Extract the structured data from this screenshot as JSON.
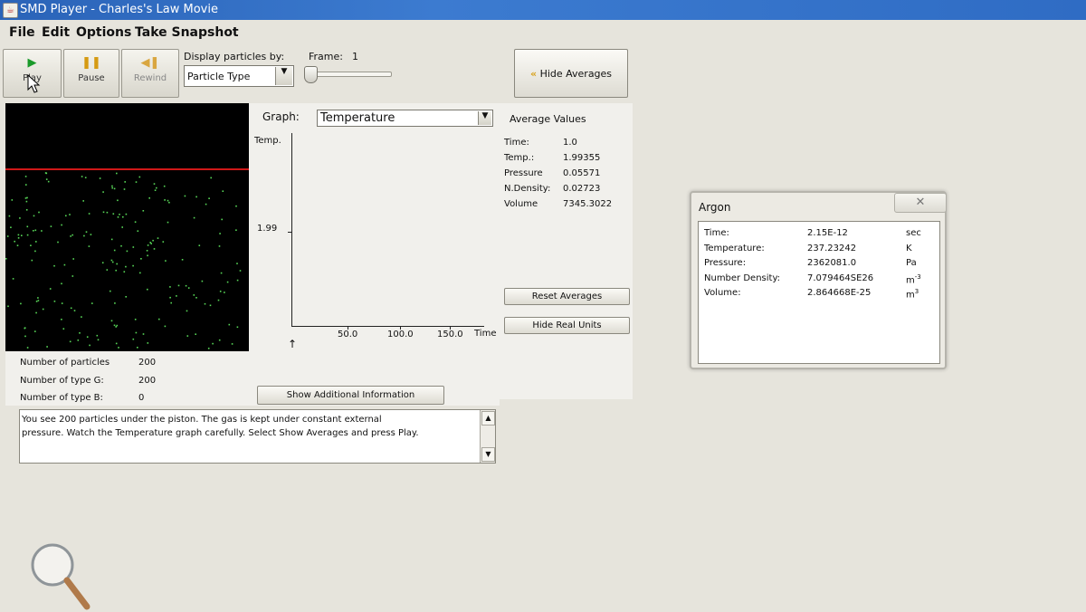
{
  "window": {
    "title": "SMD Player - Charles's Law Movie",
    "app_icon": "java-icon"
  },
  "menu": {
    "file": "File",
    "edit": "Edit",
    "options": "Options",
    "snapshot": "Take Snapshot"
  },
  "toolbar": {
    "play": "Play",
    "pause": "Pause",
    "rewind": "Rewind",
    "display_label": "Display particles by:",
    "display_value": "Particle Type",
    "frame_label": "Frame:",
    "frame_value": "1",
    "hide_averages": "Hide Averages"
  },
  "graph": {
    "label": "Graph:",
    "selected": "Temperature",
    "y_label": "Temp.",
    "y_tick": "1.99",
    "x_ticks": [
      "50.0",
      "100.0",
      "150.0"
    ],
    "x_label": "Time"
  },
  "averages": {
    "title": "Average Values",
    "rows": [
      {
        "label": "Time:",
        "value": "1.0"
      },
      {
        "label": "Temp.:",
        "value": "1.99355"
      },
      {
        "label": "Pressure",
        "value": "0.05571"
      },
      {
        "label": "N.Density:",
        "value": "0.02723"
      },
      {
        "label": "Volume",
        "value": "7345.3022"
      }
    ],
    "reset_button": "Reset Averages",
    "hide_units_button": "Hide Real Units"
  },
  "counts": {
    "rows": [
      {
        "label": "Number of particles",
        "value": "200"
      },
      {
        "label": "Number of type G:",
        "value": "200"
      },
      {
        "label": "Number of type B:",
        "value": "0"
      }
    ],
    "show_info_button": "Show Additional Information"
  },
  "description": {
    "line1": "You see 200 particles under the piston. The gas is kept under constant external",
    "line2": "pressure.  Watch the Temperature graph carefully. Select Show Averages and press Play."
  },
  "argon": {
    "title": "Argon",
    "rows": [
      {
        "label": "Time:",
        "value": "2.15E-12",
        "unit": "sec",
        "exp": ""
      },
      {
        "label": "Temperature:",
        "value": "237.23242",
        "unit": "K",
        "exp": ""
      },
      {
        "label": "Pressure:",
        "value": "2362081.0",
        "unit": "Pa",
        "exp": ""
      },
      {
        "label": "Number Density:",
        "value": "7.079464SE26",
        "unit": "m",
        "exp": "-3"
      },
      {
        "label": "Volume:",
        "value": "2.864668E-25",
        "unit": "m",
        "exp": "3"
      }
    ]
  },
  "colors": {
    "particle": "#57d657",
    "piston": "#d01818",
    "sim_bg": "#000000",
    "title_blue": "#2f6cc4"
  }
}
